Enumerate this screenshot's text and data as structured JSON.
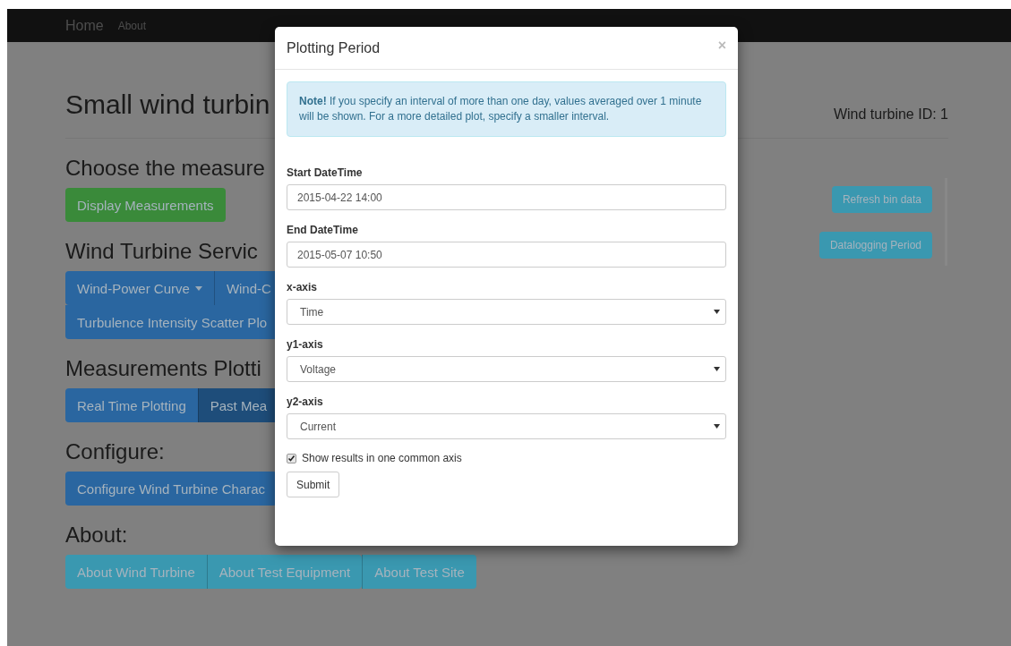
{
  "navbar": {
    "items": [
      {
        "label": "Home",
        "kind": "brand"
      },
      {
        "label": "About",
        "kind": "link"
      }
    ]
  },
  "header": {
    "title": "Small wind turbin",
    "turbine_id": "Wind turbine ID: 1"
  },
  "sections": [
    {
      "heading": "Choose the measure",
      "kind": "success",
      "rows": [
        [
          {
            "label": "Display Measurements"
          }
        ]
      ]
    },
    {
      "heading": "Wind Turbine Servic",
      "kind": "primary",
      "rows": [
        [
          {
            "label": "Wind-Power Curve",
            "dropdown": true
          },
          {
            "label": "Wind-C",
            "dropdown": false
          }
        ],
        [
          {
            "label": "Turbulence Intensity Scatter Plo",
            "dropdown": false
          }
        ]
      ]
    },
    {
      "heading": "Measurements Plotti",
      "kind": "primary",
      "rows": [
        [
          {
            "label": "Real Time Plotting",
            "selected": false
          },
          {
            "label": "Past Mea",
            "selected": true
          }
        ]
      ]
    },
    {
      "heading": "Configure:",
      "kind": "primary",
      "rows": [
        [
          {
            "label": "Configure Wind Turbine Charac"
          }
        ]
      ]
    },
    {
      "heading": "About:",
      "kind": "info",
      "rows": [
        [
          {
            "label": "About Wind Turbine"
          },
          {
            "label": "About Test Equipment"
          },
          {
            "label": "About Test Site"
          }
        ]
      ]
    }
  ],
  "side_buttons": [
    "Refresh bin data",
    "Datalogging Period"
  ],
  "modal": {
    "title": "Plotting Period",
    "close": "×",
    "alert": "**Note!** If you specify an interval of more than one day, values averaged over 1 minute will be shown. For a more detailed plot, specify a smaller interval.",
    "fields": [
      {
        "kind": "input",
        "label": "Start DateTime",
        "value": "2015-04-22 14:00"
      },
      {
        "kind": "input",
        "label": "End DateTime",
        "value": "2015-05-07 10:50"
      },
      {
        "kind": "select",
        "label": "x-axis",
        "value": "Time"
      },
      {
        "kind": "select",
        "label": "y1-axis",
        "value": "Voltage"
      },
      {
        "kind": "select",
        "label": "y2-axis",
        "value": "Current"
      }
    ],
    "checkbox": {
      "label": "Show results in one common axis",
      "checked": true
    },
    "submit": "Submit"
  }
}
